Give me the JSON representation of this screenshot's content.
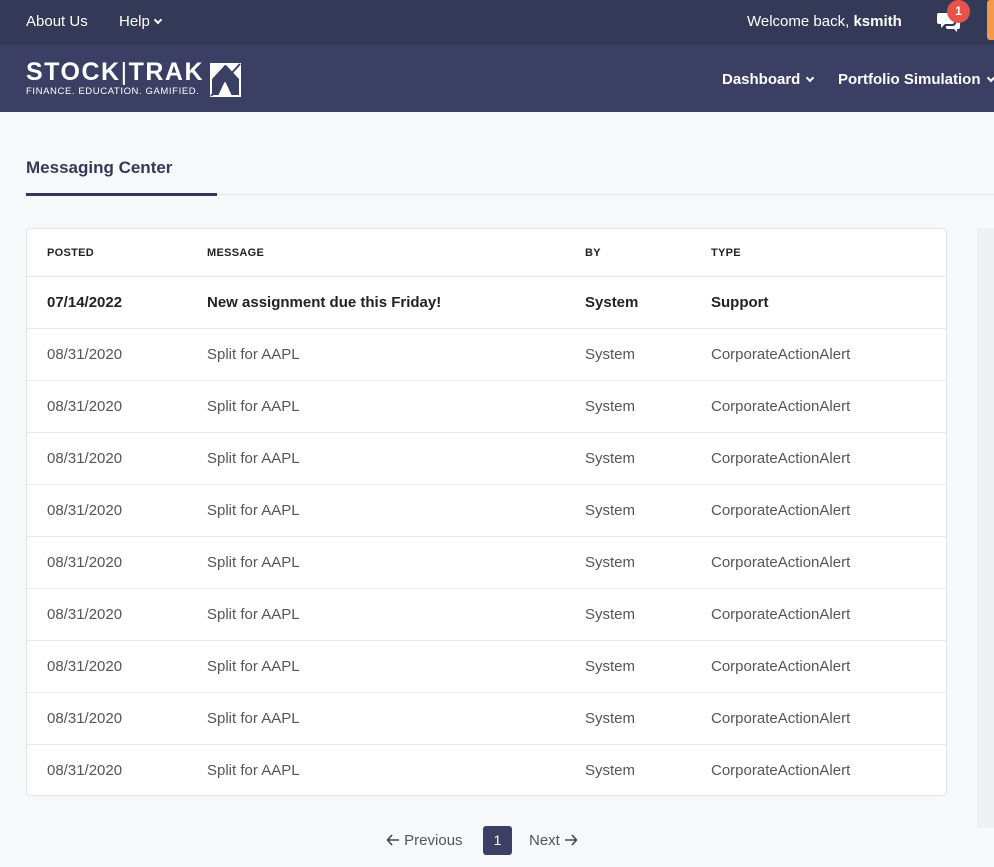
{
  "topbar": {
    "about": "About Us",
    "help": "Help",
    "welcome_prefix": "Welcome back, ",
    "username": "ksmith",
    "notification_count": "1"
  },
  "navbar": {
    "logo_text_1": "STOCK",
    "logo_sep": "|",
    "logo_text_2": "TRAK",
    "logo_tagline": "FINANCE. EDUCATION. GAMIFIED.",
    "items": [
      "Dashboard",
      "Portfolio Simulation"
    ]
  },
  "page": {
    "tab_title": "Messaging Center"
  },
  "table": {
    "headers": [
      "POSTED",
      "MESSAGE",
      "BY",
      "TYPE"
    ],
    "rows": [
      {
        "posted": "07/14/2022",
        "message": "New assignment due this Friday!",
        "by": "System",
        "type": "Support"
      },
      {
        "posted": "08/31/2020",
        "message": "Split for AAPL",
        "by": "System",
        "type": "CorporateActionAlert"
      },
      {
        "posted": "08/31/2020",
        "message": "Split for AAPL",
        "by": "System",
        "type": "CorporateActionAlert"
      },
      {
        "posted": "08/31/2020",
        "message": "Split for AAPL",
        "by": "System",
        "type": "CorporateActionAlert"
      },
      {
        "posted": "08/31/2020",
        "message": "Split for AAPL",
        "by": "System",
        "type": "CorporateActionAlert"
      },
      {
        "posted": "08/31/2020",
        "message": "Split for AAPL",
        "by": "System",
        "type": "CorporateActionAlert"
      },
      {
        "posted": "08/31/2020",
        "message": "Split for AAPL",
        "by": "System",
        "type": "CorporateActionAlert"
      },
      {
        "posted": "08/31/2020",
        "message": "Split for AAPL",
        "by": "System",
        "type": "CorporateActionAlert"
      },
      {
        "posted": "08/31/2020",
        "message": "Split for AAPL",
        "by": "System",
        "type": "CorporateActionAlert"
      },
      {
        "posted": "08/31/2020",
        "message": "Split for AAPL",
        "by": "System",
        "type": "CorporateActionAlert"
      }
    ]
  },
  "pager": {
    "prev": "Previous",
    "page": "1",
    "next": "Next"
  },
  "icons": {
    "chat": "chat-bubbles-icon",
    "prev": "arrow-left-icon",
    "next": "arrow-right-icon",
    "chevron": "chevron-down-icon"
  },
  "colors": {
    "topbar": "#343957",
    "navbar": "#3b3f63",
    "badge": "#e9524a",
    "accent_orange": "#f39a4a"
  }
}
